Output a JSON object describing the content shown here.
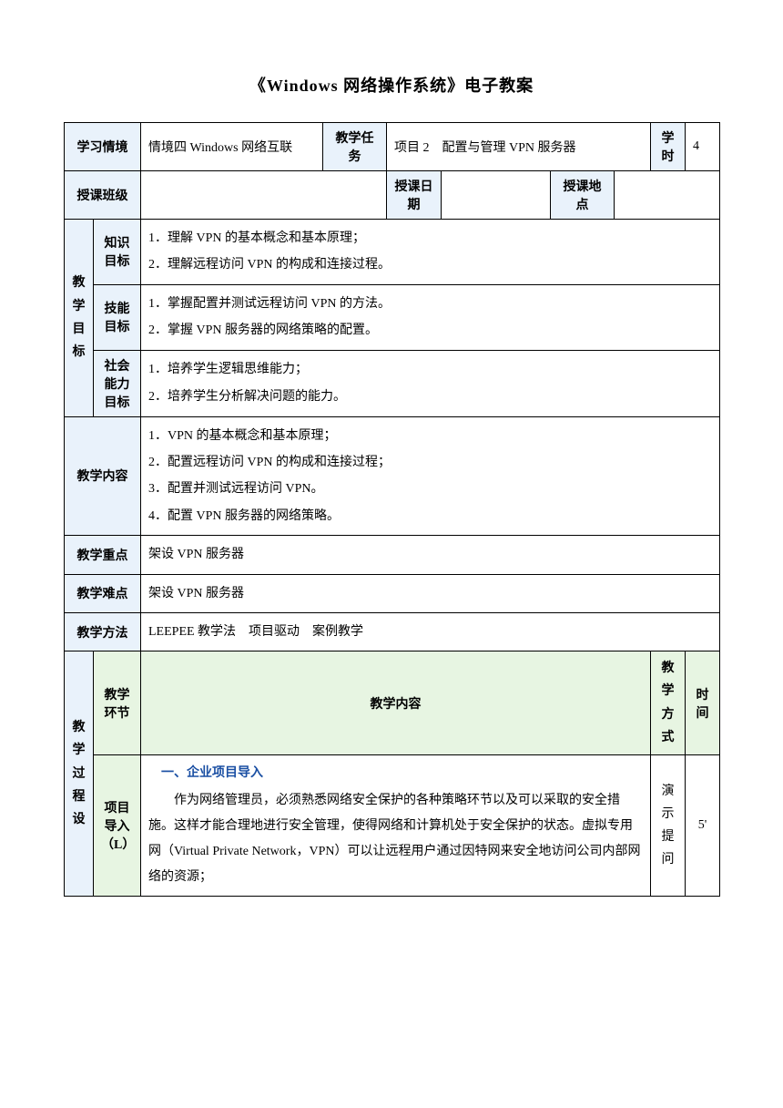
{
  "title": "《Windows 网络操作系统》电子教案",
  "row1": {
    "context_label": "学习情境",
    "context_value": "情境四  Windows 网络互联",
    "task_label": "教学任务",
    "task_value": "项目 2　配置与管理 VPN 服务器",
    "hours_label": "学时",
    "hours_value": "4"
  },
  "row2": {
    "class_label": "授课班级",
    "class_value": "",
    "date_label": "授课日期",
    "date_value": "",
    "place_label": "授课地点",
    "place_value": ""
  },
  "objectives": {
    "group_label_1": "教",
    "group_label_2": "学",
    "group_label_3": "目",
    "group_label_4": "标",
    "knowledge_label_1": "知识",
    "knowledge_label_2": "目标",
    "knowledge_items": [
      "1．理解 VPN 的基本概念和基本原理；",
      "2．理解远程访问 VPN 的构成和连接过程。"
    ],
    "skill_label_1": "技能",
    "skill_label_2": "目标",
    "skill_items": [
      "1．掌握配置并测试远程访问 VPN 的方法。",
      "2．掌握 VPN 服务器的网络策略的配置。"
    ],
    "social_label_1": "社会",
    "social_label_2": "能力",
    "social_label_3": "目标",
    "social_items": [
      "1．培养学生逻辑思维能力；",
      "2．培养学生分析解决问题的能力。"
    ]
  },
  "content": {
    "label": "教学内容",
    "items": [
      "1．VPN 的基本概念和基本原理；",
      "2．配置远程访问 VPN 的构成和连接过程；",
      "3．配置并测试远程访问 VPN。",
      "4．配置 VPN 服务器的网络策略。"
    ]
  },
  "focus": {
    "label": "教学重点",
    "value": "架设 VPN 服务器"
  },
  "difficulty": {
    "label": "教学难点",
    "value": "架设 VPN 服务器"
  },
  "method": {
    "label": "教学方法",
    "value": "LEEPEE 教学法　项目驱动　案例教学"
  },
  "process": {
    "group_label_1": "教",
    "group_label_2": "学",
    "group_label_3": "过",
    "group_label_4": "程",
    "group_label_5": "",
    "group_label_6": "设",
    "header_step": "教学\n环节",
    "header_content": "教学内容",
    "header_mode_1": "教",
    "header_mode_2": "学",
    "header_mode_3": "方",
    "header_mode_4": "式",
    "header_time": "时间",
    "step1": {
      "step_label": "项目\n导入\n（L）",
      "section_title": "一、企业项目导入",
      "paragraph": "作为网络管理员，必须熟悉网络安全保护的各种策略环节以及可以采取的安全措施。这样才能合理地进行安全管理，使得网络和计算机处于安全保护的状态。虚拟专用网（Virtual Private Network，VPN）可以让远程用户通过因特网来安全地访问公司内部网络的资源；",
      "mode_1": "演",
      "mode_2": "示",
      "mode_3": "提",
      "mode_4": "问",
      "time": "5'"
    }
  }
}
